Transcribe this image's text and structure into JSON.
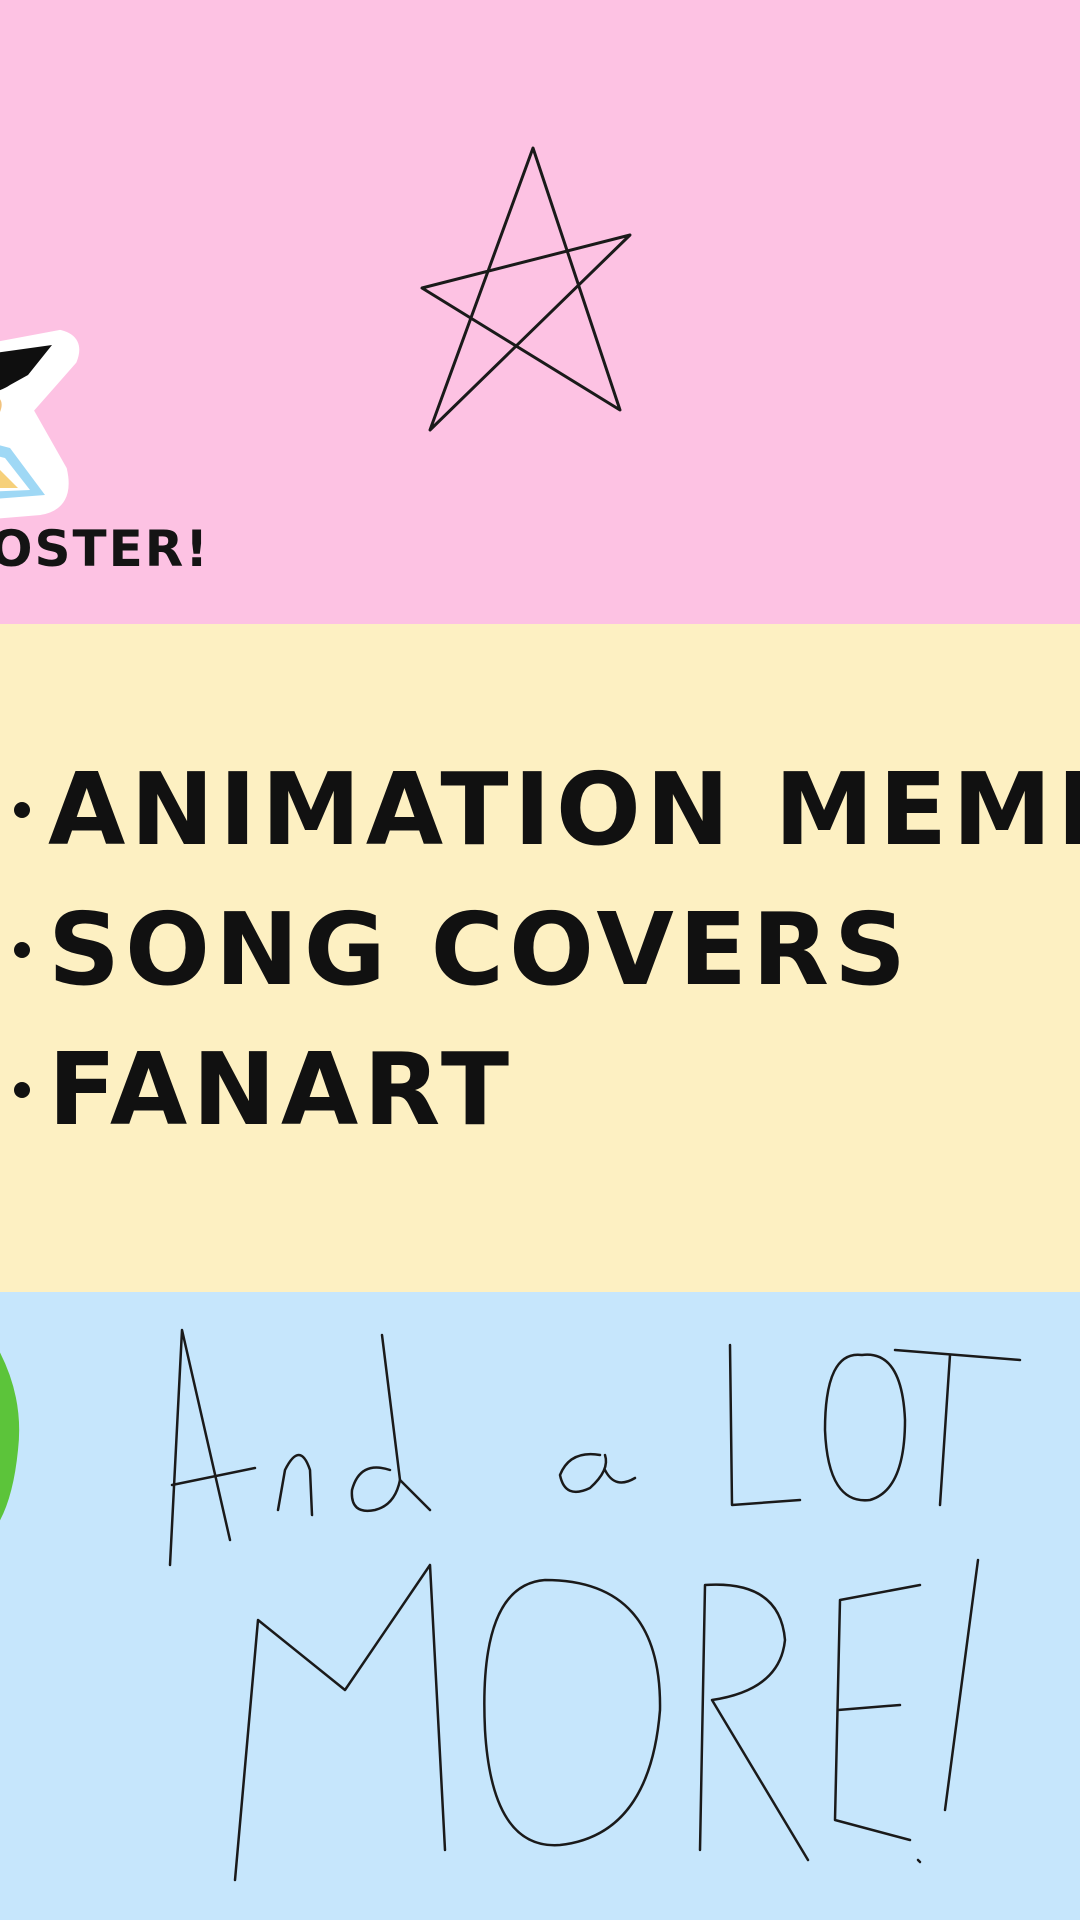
{
  "cropped_caption": "OSTER!",
  "list": {
    "items": [
      {
        "text": "ANIMATION MEMES"
      },
      {
        "text": "SONG COVERS"
      },
      {
        "text": "FANART"
      }
    ]
  },
  "handwritten_message": {
    "line1": "And a LOT",
    "line2": "MORE!"
  },
  "colors": {
    "pink_band": "#fdc2e3",
    "yellow_band": "#fdf0c2",
    "blue_band": "#c6e6fc",
    "ink": "#111111",
    "green_shape": "#5cc43a"
  },
  "icons": {
    "star": "star-doodle-icon",
    "sticker": "character-sticker-icon"
  }
}
